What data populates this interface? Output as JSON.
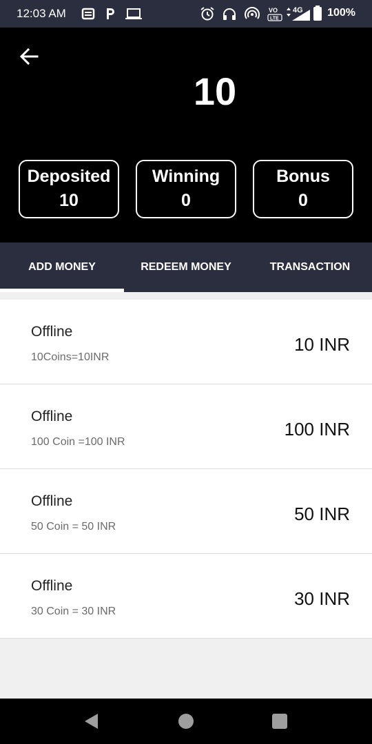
{
  "status_bar": {
    "time": "12:03 AM",
    "network": "4G",
    "volte": "VO LTE",
    "battery": "100%"
  },
  "header": {
    "balance": "10",
    "stats": [
      {
        "label": "Deposited",
        "value": "10"
      },
      {
        "label": "Winning",
        "value": "0"
      },
      {
        "label": "Bonus",
        "value": "0"
      }
    ]
  },
  "tabs": [
    {
      "label": "ADD MONEY",
      "active": true
    },
    {
      "label": "REDEEM MONEY",
      "active": false
    },
    {
      "label": "TRANSACTION",
      "active": false
    }
  ],
  "options": [
    {
      "title": "Offline",
      "subtitle": "10Coins=10INR",
      "amount": "10 INR"
    },
    {
      "title": "Offline",
      "subtitle": "100 Coin =100 INR",
      "amount": "100 INR"
    },
    {
      "title": "Offline",
      "subtitle": "50 Coin = 50 INR",
      "amount": "50 INR"
    },
    {
      "title": "Offline",
      "subtitle": "30 Coin = 30 INR",
      "amount": "30 INR"
    }
  ],
  "icons": {
    "back": "arrow-left-icon",
    "nav_back": "triangle-back-icon",
    "nav_home": "circle-home-icon",
    "nav_recents": "square-recents-icon"
  }
}
